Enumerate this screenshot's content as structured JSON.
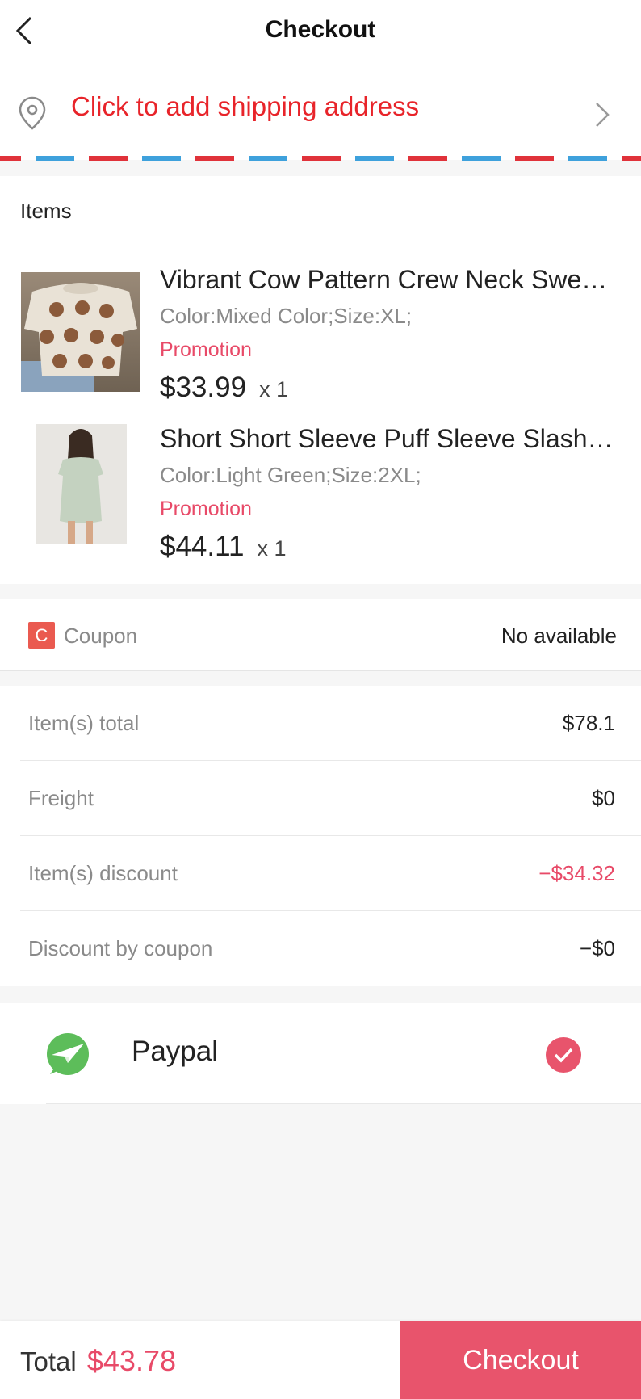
{
  "header": {
    "title": "Checkout"
  },
  "address": {
    "prompt": "Click to add shipping address"
  },
  "items": {
    "heading": "Items",
    "products": [
      {
        "name": "Vibrant Cow Pattern Crew Neck Sweatshirt",
        "variant": "Color:Mixed Color;Size:XL;",
        "promo": "Promotion",
        "price": "$33.99",
        "qty": "x 1"
      },
      {
        "name": "Short Short Sleeve Puff Sleeve Slash Neck Dress",
        "variant": "Color:Light Green;Size:2XL;",
        "promo": "Promotion",
        "price": "$44.11",
        "qty": "x 1"
      }
    ]
  },
  "coupon": {
    "badge": "C",
    "label": "Coupon",
    "value": "No available"
  },
  "summary": [
    {
      "label": "Item(s) total",
      "value": "$78.1"
    },
    {
      "label": "Freight",
      "value": "$0"
    },
    {
      "label": "Item(s) discount",
      "value": "−$34.32"
    },
    {
      "label": "Discount by coupon",
      "value": "−$0"
    }
  ],
  "payment": {
    "method": "Paypal",
    "selected": true
  },
  "footer": {
    "total_label": "Total",
    "total_amount": "$43.78",
    "checkout_label": "Checkout"
  },
  "colors": {
    "accent": "#e8546c",
    "address_red": "#e8242a",
    "paypal_green": "#5dbd5a"
  }
}
